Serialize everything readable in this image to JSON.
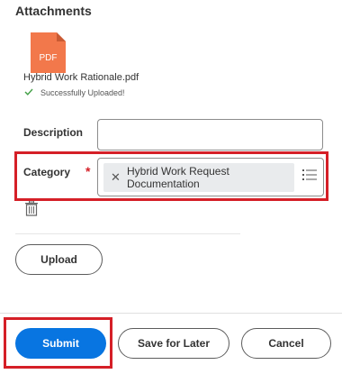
{
  "attachments": {
    "title": "Attachments",
    "file": {
      "extension": "PDF",
      "icon_color": "#f2784b",
      "name": "Hybrid Work Rationale.pdf",
      "status": "Successfully Uploaded!",
      "status_icon": "check-icon",
      "status_color": "#43a047"
    }
  },
  "form": {
    "description_label": "Description",
    "description_value": "",
    "category_label": "Category",
    "required_marker": "*",
    "category_selected": "Hybrid Work Request Documentation",
    "category_list_icon": "list-icon",
    "delete_icon": "trash-icon"
  },
  "buttons": {
    "upload": "Upload",
    "submit": "Submit",
    "save_for_later": "Save for Later",
    "cancel": "Cancel"
  },
  "colors": {
    "primary": "#0875e1",
    "highlight": "#d51f27"
  }
}
